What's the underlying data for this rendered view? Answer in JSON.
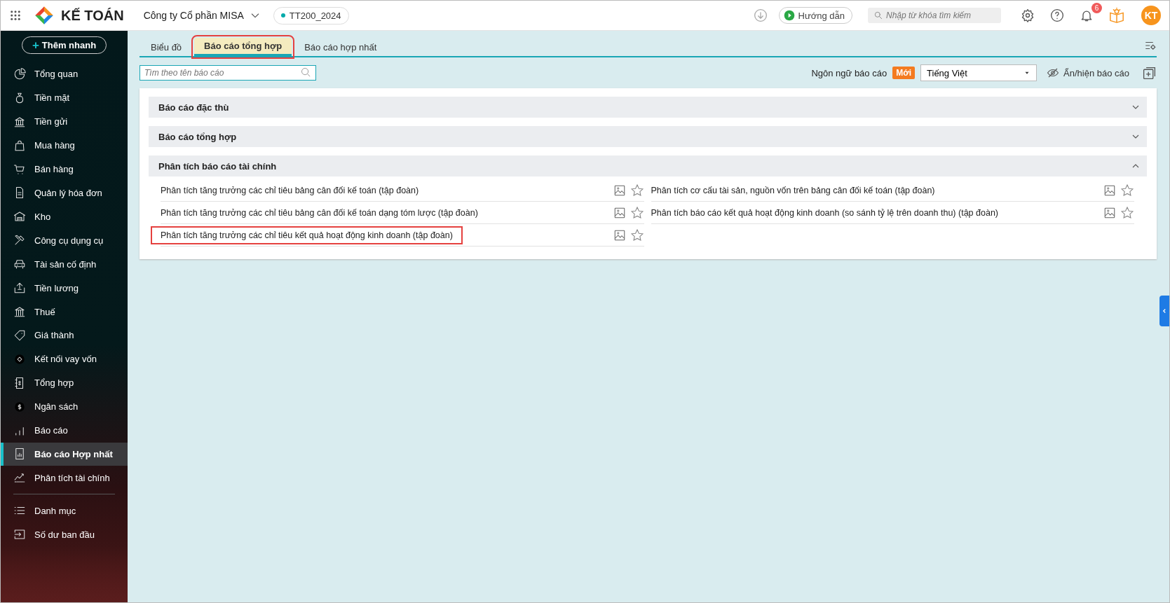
{
  "topbar": {
    "app_name": "KẾ TOÁN",
    "company": "Công ty Cổ phần MISA",
    "database": "TT200_2024",
    "guide_button": "Hướng dẫn",
    "search": {
      "placeholder": "Nhập từ khóa tìm kiếm"
    },
    "notification_count": "6",
    "avatar": "KT"
  },
  "sidebar": {
    "quick_add": {
      "icon": "+",
      "label": "Thêm nhanh"
    },
    "items": [
      {
        "label": "Tổng quan",
        "selected": false
      },
      {
        "label": "Tiền mặt",
        "selected": false
      },
      {
        "label": "Tiền gửi",
        "selected": false
      },
      {
        "label": "Mua hàng",
        "selected": false
      },
      {
        "label": "Bán hàng",
        "selected": false
      },
      {
        "label": "Quản lý hóa đơn",
        "selected": false
      },
      {
        "label": "Kho",
        "selected": false
      },
      {
        "label": "Công cụ dụng cụ",
        "selected": false
      },
      {
        "label": "Tài sản cố định",
        "selected": false
      },
      {
        "label": "Tiền lương",
        "selected": false
      },
      {
        "label": "Thuế",
        "selected": false
      },
      {
        "label": "Giá thành",
        "selected": false
      },
      {
        "label": "Kết nối vay vốn",
        "selected": false
      },
      {
        "label": "Tổng hợp",
        "selected": false
      },
      {
        "label": "Ngân sách",
        "selected": false
      },
      {
        "label": "Báo cáo",
        "selected": false
      },
      {
        "label": "Báo cáo Hợp nhất",
        "selected": true
      },
      {
        "label": "Phân tích tài chính",
        "selected": false
      }
    ],
    "bottom_items": [
      {
        "label": "Danh mục",
        "selected": false
      },
      {
        "label": "Số dư ban đầu",
        "selected": false
      }
    ]
  },
  "tabs": [
    {
      "label": "Biểu đồ",
      "selected": false,
      "highlighted": false
    },
    {
      "label": "Báo cáo tổng hợp",
      "selected": true,
      "highlighted": true
    },
    {
      "label": "Báo cáo hợp nhất",
      "selected": false,
      "highlighted": false
    }
  ],
  "report_search": {
    "placeholder": "Tìm theo tên báo cáo"
  },
  "language": {
    "label": "Ngôn ngữ báo cáo",
    "badge": "Mới",
    "value": "Tiếng Việt"
  },
  "toggle_reports": "Ẩn/hiện báo cáo",
  "sections": [
    {
      "title": "Báo cáo đặc thù",
      "expanded": false
    },
    {
      "title": "Báo cáo tổng hợp",
      "expanded": false
    },
    {
      "title": "Phân tích báo cáo tài chính",
      "expanded": true,
      "items": [
        {
          "label": "Phân tích tăng trưởng các chỉ tiêu bảng cân đối kế toán (tập đoàn)",
          "favorite": false,
          "highlighted": false
        },
        {
          "label": "Phân tích cơ cấu tài sản, nguồn vốn trên bảng cân đối kế toán (tập đoàn)",
          "favorite": false,
          "highlighted": false
        },
        {
          "label": "Phân tích tăng trưởng các chỉ tiêu bảng cân đối kế toán dạng tóm lược (tập đoàn)",
          "favorite": false,
          "highlighted": false
        },
        {
          "label": "Phân tích báo cáo kết quả hoạt động kinh doanh (so sánh tỷ lệ trên doanh thu) (tập đoàn)",
          "favorite": false,
          "highlighted": false
        },
        {
          "label": "Phân tích tăng trưởng các chỉ tiêu kết quả hoạt động kinh doanh (tập đoàn)",
          "favorite": false,
          "highlighted": true
        }
      ]
    }
  ]
}
